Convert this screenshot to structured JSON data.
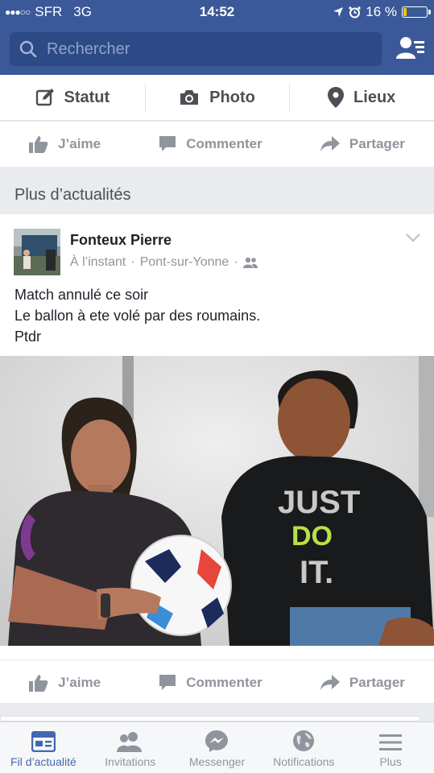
{
  "status_bar": {
    "signal_dots": "●●●○○",
    "carrier": "SFR",
    "network": "3G",
    "time": "14:52",
    "battery": "16 %",
    "battery_level": 0.16,
    "battery_color": "#f5c400"
  },
  "header": {
    "search_placeholder": "Rechercher",
    "brand_color": "#3b5998"
  },
  "composer": {
    "status_label": "Statut",
    "photo_label": "Photo",
    "places_label": "Lieux"
  },
  "actions": {
    "like": "J’aime",
    "comment": "Commenter",
    "share": "Partager"
  },
  "section": {
    "title": "Plus d’actualités"
  },
  "post": {
    "author": "Fonteux Pierre",
    "time": "À l’instant",
    "location": "Pont-sur-Yonne",
    "separator": "·",
    "lines": [
      "Match annulé ce soir",
      "Le ballon à ete volé par des roumains.",
      "Ptdr"
    ],
    "photo_text": {
      "shirt_line1": "JUST",
      "shirt_line2": "DO",
      "shirt_line3": "IT."
    }
  },
  "tabbar": {
    "items": [
      {
        "label": "Fil d’actualité",
        "icon": "news-feed-icon"
      },
      {
        "label": "Invitations",
        "icon": "friends-icon"
      },
      {
        "label": "Messenger",
        "icon": "messenger-icon"
      },
      {
        "label": "Notifications",
        "icon": "globe-icon"
      },
      {
        "label": "Plus",
        "icon": "menu-icon"
      }
    ],
    "active_color": "#4267b2"
  }
}
